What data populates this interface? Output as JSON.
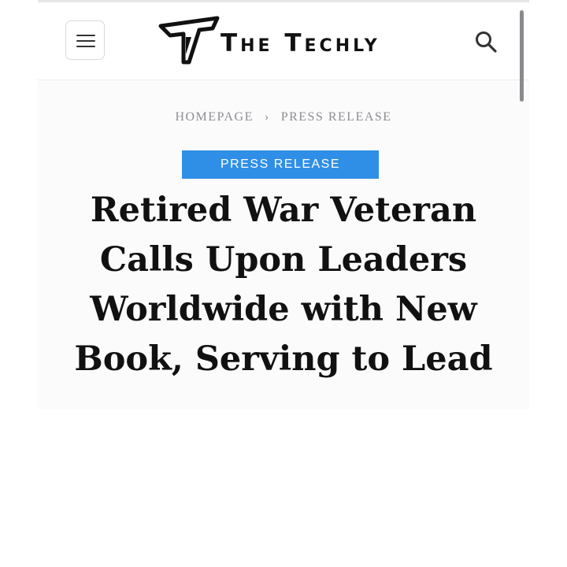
{
  "header": {
    "logo_text": "The Techly",
    "menu_icon": "hamburger-menu-icon",
    "search_icon": "search-icon"
  },
  "breadcrumb": {
    "home": "HOMEPAGE",
    "separator": "›",
    "current": "PRESS RELEASE"
  },
  "article": {
    "category": "PRESS RELEASE",
    "title": "Retired War Veteran Calls Upon Leaders Worldwide with New Book, Serving to Lead"
  },
  "colors": {
    "badge_background": "#2f8fe6",
    "headline": "#111111",
    "breadcrumb": "#8d8d93"
  }
}
